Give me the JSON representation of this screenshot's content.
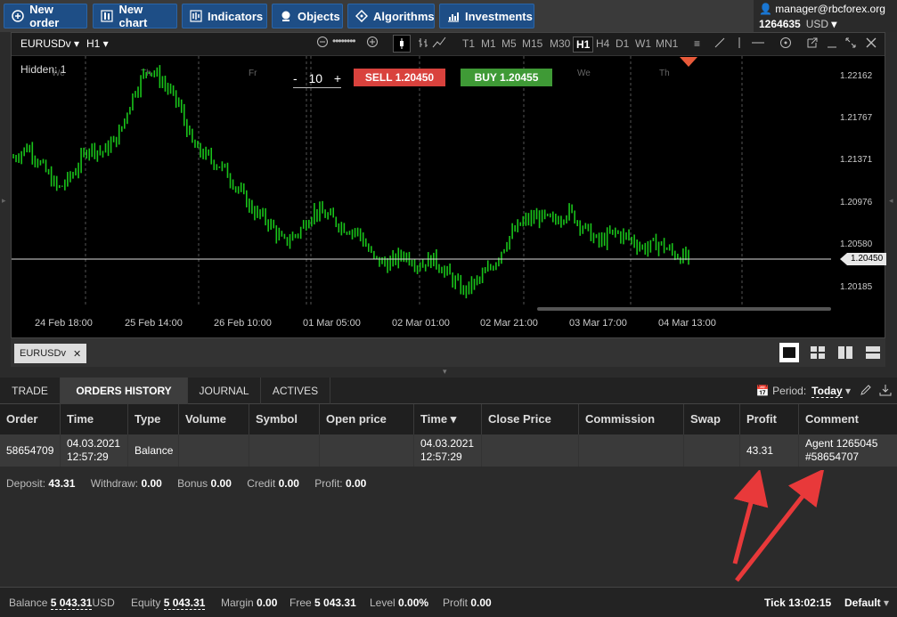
{
  "toolbar": {
    "new_order": "New order",
    "new_chart": "New chart",
    "indicators": "Indicators",
    "objects": "Objects",
    "algorithms": "Algorithms",
    "investments": "Investments"
  },
  "account": {
    "email": "manager@rbcforex.org",
    "number": "1264635",
    "currency": "USD"
  },
  "chart": {
    "symbol": "EURUSDv",
    "timeframe": "H1",
    "timeframes": [
      "T1",
      "M1",
      "M5",
      "M15",
      "M30",
      "H1",
      "H4",
      "D1",
      "W1",
      "MN1"
    ],
    "active_timeframe": "H1",
    "hidden_label": "Hidden: 1",
    "lot_minus": "-",
    "lot_value": "10",
    "lot_plus": "+",
    "sell_label": "SELL 1.20450",
    "buy_label": "BUY 1.20455",
    "day_labels": [
      "We",
      "Th",
      "Fr",
      "We",
      "Th"
    ],
    "price_ticks": [
      "1.22162",
      "1.21767",
      "1.21371",
      "1.20976",
      "1.20580",
      "1.20185"
    ],
    "current_price": "1.20450",
    "time_ticks": [
      "24 Feb 18:00",
      "25 Feb 14:00",
      "26 Feb 10:00",
      "01 Mar 05:00",
      "02 Mar 01:00",
      "02 Mar 21:00",
      "03 Mar 17:00",
      "04 Mar 13:00"
    ],
    "colors": {
      "up": "#19c41a",
      "sell": "#d9423d",
      "buy": "#3f9a36"
    }
  },
  "chart_tab": {
    "label": "EURUSDv",
    "close": "✕"
  },
  "bottom_tabs": [
    "TRADE",
    "ORDERS HISTORY",
    "JOURNAL",
    "ACTIVES"
  ],
  "active_bottom_tab": "ORDERS HISTORY",
  "period": {
    "label": "Period:",
    "value": "Today"
  },
  "table": {
    "headers": [
      "Order",
      "Time",
      "Type",
      "Volume",
      "Symbol",
      "Open price",
      "Time ▾",
      "Close Price",
      "Commission",
      "Swap",
      "Profit",
      "Comment"
    ],
    "rows": [
      {
        "order": "58654709",
        "time_date": "04.03.2021",
        "time_clock": "12:57:29",
        "type": "Balance",
        "volume": "",
        "symbol": "",
        "open_price": "",
        "close_time_date": "04.03.2021",
        "close_time_clock": "12:57:29",
        "close_price": "",
        "commission": "",
        "swap": "",
        "profit": "43.31",
        "comment_line1": "Agent 1265045",
        "comment_line2": "#58654707"
      }
    ]
  },
  "summary": {
    "deposit_label": "Deposit:",
    "deposit": "43.31",
    "withdraw_label": "Withdraw:",
    "withdraw": "0.00",
    "bonus_label": "Bonus",
    "bonus": "0.00",
    "credit_label": "Credit",
    "credit": "0.00",
    "profit_label": "Profit:",
    "profit": "0.00"
  },
  "footer": {
    "balance_label": "Balance",
    "balance": "5 043.31",
    "balance_ccy": "USD",
    "equity_label": "Equity",
    "equity": "5 043.31",
    "margin_label": "Margin",
    "margin": "0.00",
    "free_label": "Free",
    "free": "5 043.31",
    "level_label": "Level",
    "level": "0.00%",
    "profit_label": "Profit",
    "profit": "0.00",
    "tick_label": "Tick",
    "tick": "13:02:15",
    "profile": "Default"
  }
}
